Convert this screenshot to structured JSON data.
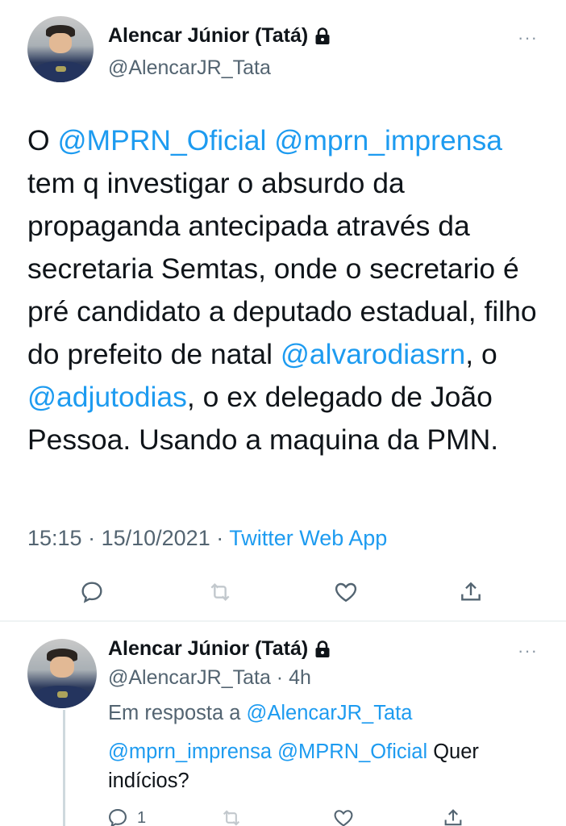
{
  "tweet": {
    "author_name": "Alencar Júnior (Tatá)",
    "handle": "@AlencarJR_Tata",
    "text": {
      "p1": "O ",
      "m1": "@MPRN_Oficial",
      "p2": " ",
      "m2": "@mprn_imprensa",
      "p3": " tem q investigar o absurdo da propaganda antecipada através da secretaria Semtas, onde o secretario é pré candidato a deputado estadual, filho do prefeito de natal ",
      "m3": "@alvarodiasrn",
      "p4": ", o ",
      "m4": "@adjutodias",
      "p5": ", o ex delegado de João Pessoa. Usando a maquina da PMN."
    },
    "time": "15:15",
    "separator1": " · ",
    "date": "15/10/2021",
    "separator2": " · ",
    "source": "Twitter Web App",
    "icons": [
      "reply-icon",
      "retweet-icon",
      "like-icon",
      "share-icon"
    ]
  },
  "reply": {
    "author_name": "Alencar Júnior (Tatá)",
    "handle": "@AlencarJR_Tata",
    "time_sep": " · ",
    "time": "4h",
    "replying_prefix": "Em resposta a ",
    "replying_to": "@AlencarJR_Tata",
    "text": {
      "m1": "@mprn_imprensa",
      "sp": " ",
      "m2": "@MPRN_Oficial",
      "p1": " Quer indícios?"
    },
    "reply_count": "1"
  },
  "more_label": "···",
  "colors": {
    "link": "#1d9bf0",
    "secondary": "#536471",
    "text": "#0f1419"
  }
}
